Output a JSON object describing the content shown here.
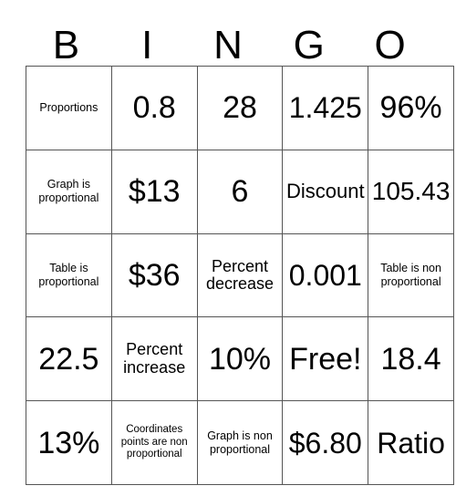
{
  "card": {
    "title": "BINGO",
    "header_letters": [
      "B",
      "I",
      "N",
      "G",
      "O"
    ],
    "rows": [
      [
        {
          "text": "Proportions",
          "size": "sz-xxs"
        },
        {
          "text": "0.8",
          "size": "sz-xl"
        },
        {
          "text": "28",
          "size": "sz-xl"
        },
        {
          "text": "1.425",
          "size": "sz-lg"
        },
        {
          "text": "96%",
          "size": "sz-xl"
        }
      ],
      [
        {
          "text": "Graph is proportional",
          "size": "sz-xxs"
        },
        {
          "text": "$13",
          "size": "sz-xl"
        },
        {
          "text": "6",
          "size": "sz-xl"
        },
        {
          "text": "Discount",
          "size": "sz-sm"
        },
        {
          "text": "105.43",
          "size": "sz-md"
        }
      ],
      [
        {
          "text": "Table is proportional",
          "size": "sz-xxs"
        },
        {
          "text": "$36",
          "size": "sz-xl"
        },
        {
          "text": "Percent decrease",
          "size": "sz-xs"
        },
        {
          "text": "0.001",
          "size": "sz-lg"
        },
        {
          "text": "Table is non proportional",
          "size": "sz-xxs"
        }
      ],
      [
        {
          "text": "22.5",
          "size": "sz-xl"
        },
        {
          "text": "Percent increase",
          "size": "sz-xs"
        },
        {
          "text": "10%",
          "size": "sz-xl"
        },
        {
          "text": "Free!",
          "size": "sz-xl"
        },
        {
          "text": "18.4",
          "size": "sz-xl"
        }
      ],
      [
        {
          "text": "13%",
          "size": "sz-xl"
        },
        {
          "text": "Coordinates points are non proportional",
          "size": "sz-tiny"
        },
        {
          "text": "Graph is non proportional",
          "size": "sz-xxs"
        },
        {
          "text": "$6.80",
          "size": "sz-lg"
        },
        {
          "text": "Ratio",
          "size": "sz-lg"
        }
      ]
    ]
  },
  "style": {
    "background_color": "#ffffff",
    "text_color": "#000000",
    "grid_line_color": "#555555"
  }
}
